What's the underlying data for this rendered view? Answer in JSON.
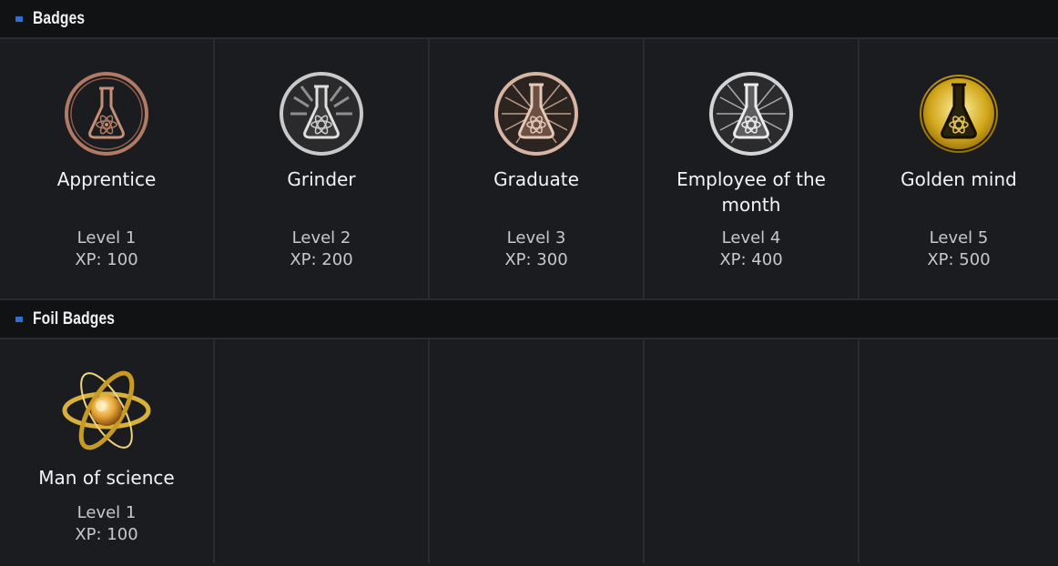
{
  "sections": {
    "badges": {
      "title": "Badges",
      "items": [
        {
          "name": "Apprentice",
          "level": "Level 1",
          "xp": "XP: 100",
          "icon": "copper-flask-badge-icon"
        },
        {
          "name": "Grinder",
          "level": "Level 2",
          "xp": "XP: 200",
          "icon": "silver-flask-badge-icon"
        },
        {
          "name": "Graduate",
          "level": "Level 3",
          "xp": "XP: 300",
          "icon": "bronze-flask-badge-icon"
        },
        {
          "name": "Employee of the month",
          "level": "Level 4",
          "xp": "XP: 400",
          "icon": "platinum-flask-badge-icon"
        },
        {
          "name": "Golden mind",
          "level": "Level 5",
          "xp": "XP: 500",
          "icon": "gold-flask-badge-icon"
        }
      ]
    },
    "foil": {
      "title": "Foil Badges",
      "items": [
        {
          "name": "Man of science",
          "level": "Level 1",
          "xp": "XP: 100",
          "icon": "gold-atom-foil-badge-icon"
        }
      ]
    }
  },
  "colors": {
    "accent": "#2f6fd1",
    "background": "#1b1c20",
    "header": "#111214"
  }
}
